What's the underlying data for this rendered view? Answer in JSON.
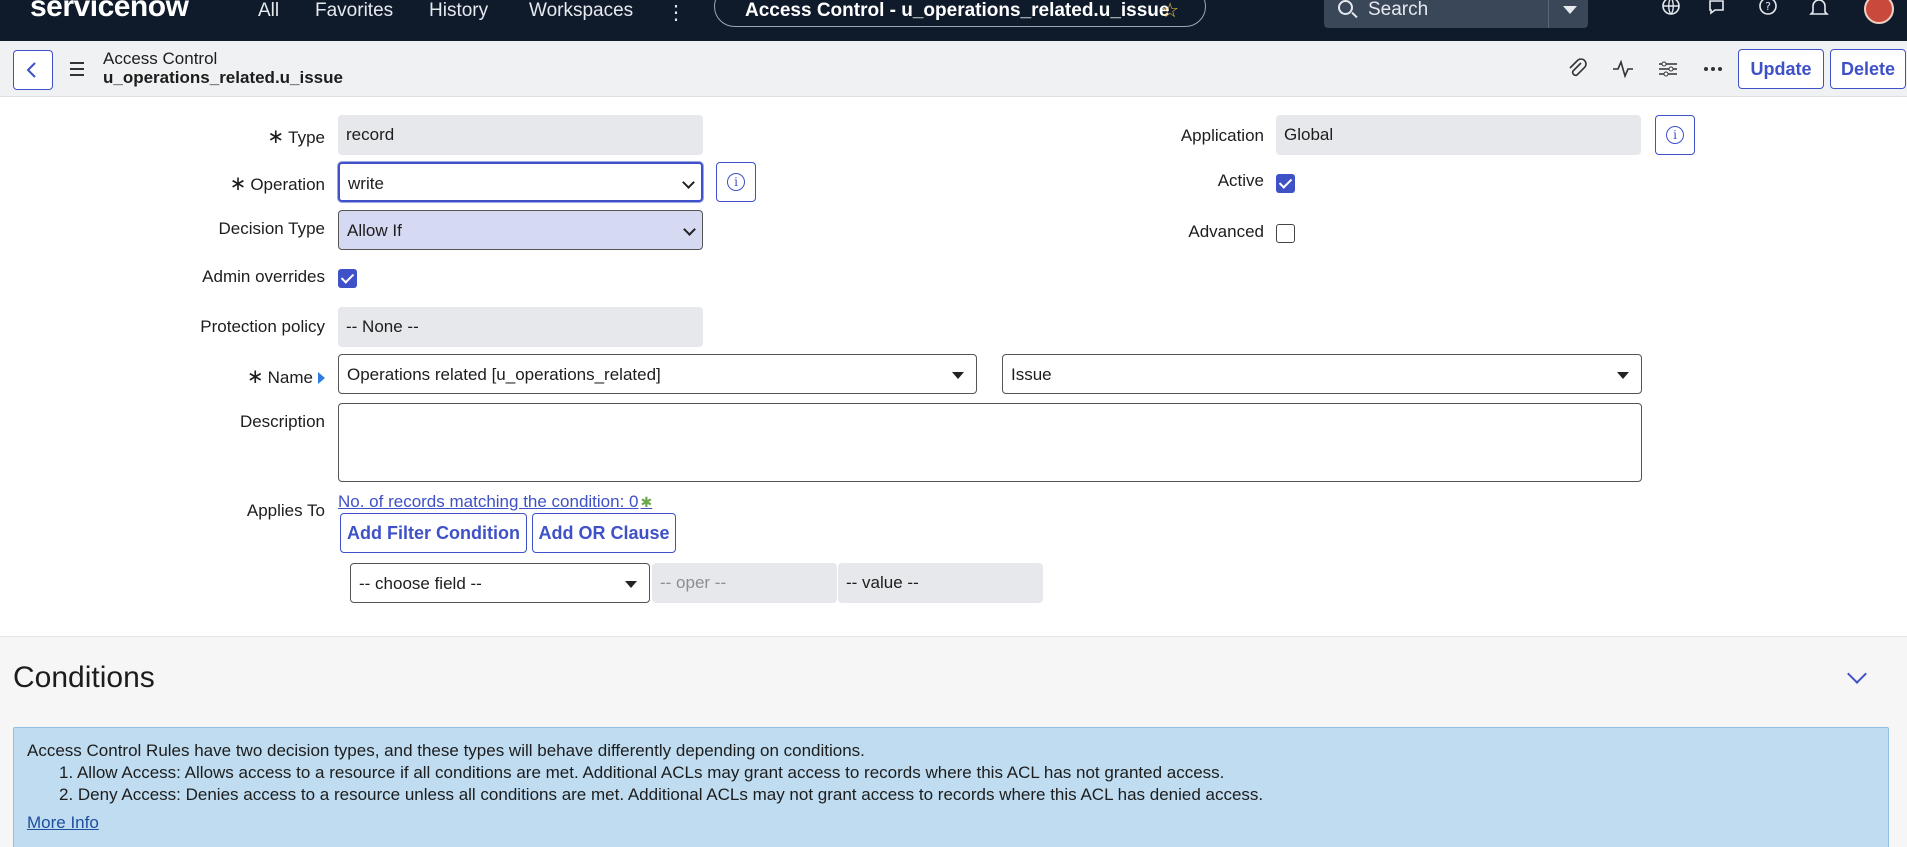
{
  "topnav": {
    "logo": "servicenow",
    "links": [
      "All",
      "Favorites",
      "History",
      "Workspaces"
    ],
    "more": "⋮",
    "record_title": "Access Control - u_operations_related.u_issue",
    "search_placeholder": "Search"
  },
  "record_header": {
    "title": "Access Control",
    "subtitle": "u_operations_related.u_issue",
    "update_label": "Update",
    "delete_label": "Delete"
  },
  "form": {
    "type_label": "Type",
    "type_value": "record",
    "operation_label": "Operation",
    "operation_value": "write",
    "decision_label": "Decision Type",
    "decision_value": "Allow If",
    "admin_overrides_label": "Admin overrides",
    "admin_overrides_checked": true,
    "protection_label": "Protection policy",
    "protection_value": "-- None --",
    "name_label": "Name",
    "name_table": "Operations related [u_operations_related]",
    "name_field": "Issue",
    "description_label": "Description",
    "description_value": "",
    "applies_label": "Applies To",
    "match_link": "No. of records matching the condition: 0",
    "add_filter_label": "Add Filter Condition",
    "add_or_label": "Add OR Clause",
    "choose_field": "-- choose field --",
    "oper": "-- oper --",
    "value": "-- value --",
    "application_label": "Application",
    "application_value": "Global",
    "active_label": "Active",
    "active_checked": true,
    "advanced_label": "Advanced",
    "advanced_checked": false
  },
  "conditions": {
    "title": "Conditions",
    "intro": "Access Control Rules have two decision types, and these types will behave differently depending on conditions.",
    "items": [
      "1. Allow Access: Allows access to a resource if all conditions are met. Additional ACLs may grant access to records where this ACL has not granted access.",
      "2. Deny Access: Denies access to a resource unless all conditions are met. Additional ACLs may not grant access to records where this ACL has denied access."
    ],
    "more_info": "More Info"
  },
  "colors": {
    "nav_bg": "#0f1a2b",
    "accent": "#3f51c7",
    "info_bg": "#bfdcf0"
  }
}
